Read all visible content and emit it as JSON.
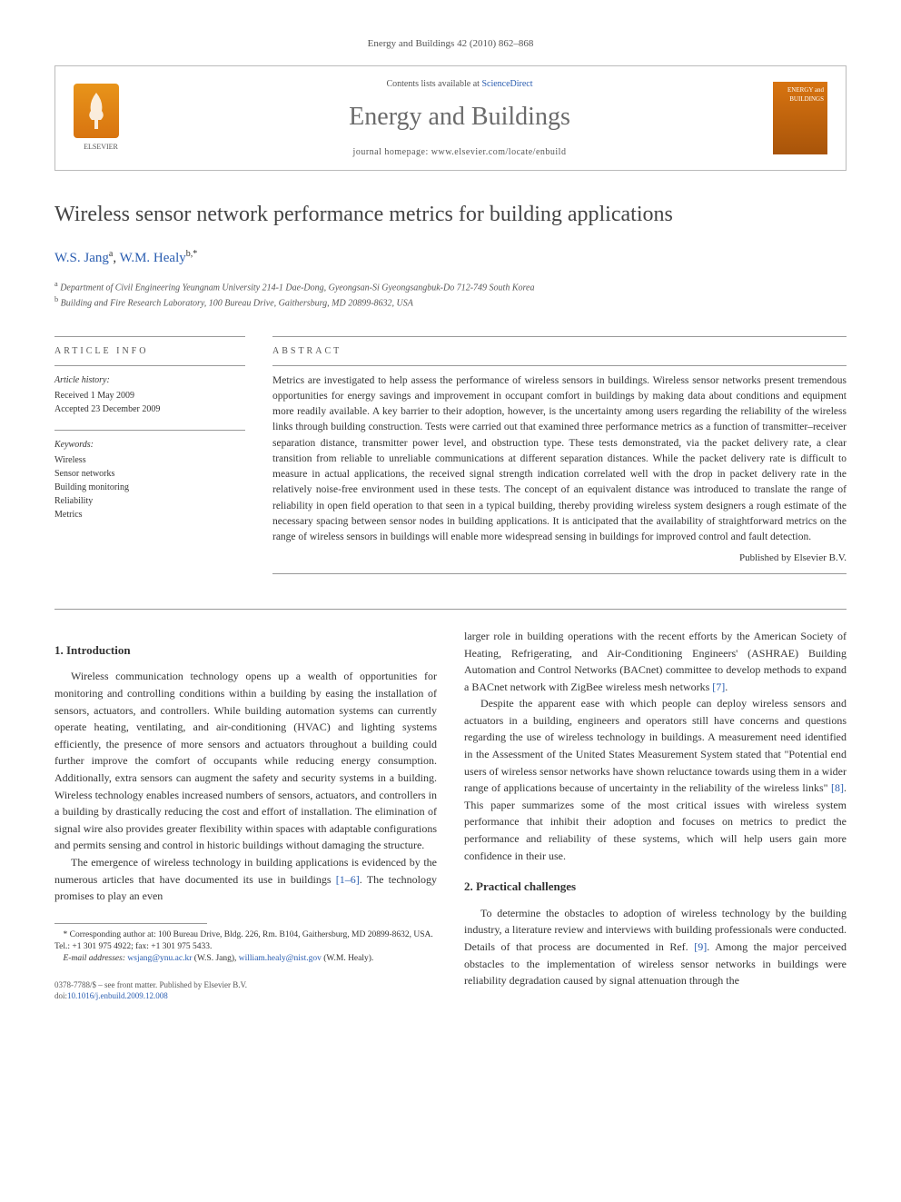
{
  "header": {
    "citation": "Energy and Buildings 42 (2010) 862–868"
  },
  "banner": {
    "contents_prefix": "Contents lists available at ",
    "contents_link": "ScienceDirect",
    "journal_name": "Energy and Buildings",
    "homepage_prefix": "journal homepage: ",
    "homepage_url": "www.elsevier.com/locate/enbuild",
    "elsevier_label": "ELSEVIER",
    "cover_label": "ENERGY and BUILDINGS"
  },
  "article": {
    "title": "Wireless sensor network performance metrics for building applications",
    "authors_html": {
      "a1_name": "W.S. Jang",
      "a1_sup": "a",
      "a2_name": "W.M. Healy",
      "a2_sup": "b,*"
    },
    "affiliations": {
      "a": "Department of Civil Engineering Yeungnam University 214-1 Dae-Dong, Gyeongsan-Si Gyeongsangbuk-Do 712-749 South Korea",
      "b": "Building and Fire Research Laboratory, 100 Bureau Drive, Gaithersburg, MD 20899-8632, USA"
    }
  },
  "info": {
    "heading_info": "ARTICLE INFO",
    "history_label": "Article history:",
    "received": "Received 1 May 2009",
    "accepted": "Accepted 23 December 2009",
    "keywords_label": "Keywords:",
    "keywords": [
      "Wireless",
      "Sensor networks",
      "Building monitoring",
      "Reliability",
      "Metrics"
    ]
  },
  "abstract": {
    "heading": "ABSTRACT",
    "text": "Metrics are investigated to help assess the performance of wireless sensors in buildings. Wireless sensor networks present tremendous opportunities for energy savings and improvement in occupant comfort in buildings by making data about conditions and equipment more readily available. A key barrier to their adoption, however, is the uncertainty among users regarding the reliability of the wireless links through building construction. Tests were carried out that examined three performance metrics as a function of transmitter–receiver separation distance, transmitter power level, and obstruction type. These tests demonstrated, via the packet delivery rate, a clear transition from reliable to unreliable communications at different separation distances. While the packet delivery rate is difficult to measure in actual applications, the received signal strength indication correlated well with the drop in packet delivery rate in the relatively noise-free environment used in these tests. The concept of an equivalent distance was introduced to translate the range of reliability in open field operation to that seen in a typical building, thereby providing wireless system designers a rough estimate of the necessary spacing between sensor nodes in building applications. It is anticipated that the availability of straightforward metrics on the range of wireless sensors in buildings will enable more widespread sensing in buildings for improved control and fault detection.",
    "publisher": "Published by Elsevier B.V."
  },
  "body": {
    "s1_heading": "1. Introduction",
    "s1_p1": "Wireless communication technology opens up a wealth of opportunities for monitoring and controlling conditions within a building by easing the installation of sensors, actuators, and controllers. While building automation systems can currently operate heating, ventilating, and air-conditioning (HVAC) and lighting systems efficiently, the presence of more sensors and actuators throughout a building could further improve the comfort of occupants while reducing energy consumption. Additionally, extra sensors can augment the safety and security systems in a building. Wireless technology enables increased numbers of sensors, actuators, and controllers in a building by drastically reducing the cost and effort of installation. The elimination of signal wire also provides greater flexibility within spaces with adaptable configurations and permits sensing and control in historic buildings without damaging the structure.",
    "s1_p2_pre": "The emergence of wireless technology in building applications is evidenced by the numerous articles that have documented its use in buildings ",
    "s1_p2_ref1": "[1–6]",
    "s1_p2_post": ". The technology promises to play an even",
    "col2_p1_pre": "larger role in building operations with the recent efforts by the American Society of Heating, Refrigerating, and Air-Conditioning Engineers' (ASHRAE) Building Automation and Control Networks (BACnet) committee to develop methods to expand a BACnet network with ZigBee wireless mesh networks ",
    "col2_p1_ref": "[7]",
    "col2_p1_post": ".",
    "col2_p2_pre": "Despite the apparent ease with which people can deploy wireless sensors and actuators in a building, engineers and operators still have concerns and questions regarding the use of wireless technology in buildings. A measurement need identified in the Assessment of the United States Measurement System stated that \"Potential end users of wireless sensor networks have shown reluctance towards using them in a wider range of applications because of uncertainty in the reliability of the wireless links\" ",
    "col2_p2_ref": "[8]",
    "col2_p2_post": ". This paper summarizes some of the most critical issues with wireless system performance that inhibit their adoption and focuses on metrics to predict the performance and reliability of these systems, which will help users gain more confidence in their use.",
    "s2_heading": "2. Practical challenges",
    "s2_p1_pre": "To determine the obstacles to adoption of wireless technology by the building industry, a literature review and interviews with building professionals were conducted. Details of that process are documented in Ref. ",
    "s2_p1_ref": "[9]",
    "s2_p1_post": ". Among the major perceived obstacles to the implementation of wireless sensor networks in buildings were reliability degradation caused by signal attenuation through the"
  },
  "footnotes": {
    "corr_label": "* Corresponding author at: 100 Bureau Drive, Bldg. 226, Rm. B104, Gaithersburg, MD 20899-8632, USA. Tel.: +1 301 975 4922; fax: +1 301 975 5433.",
    "email_label": "E-mail addresses: ",
    "email1": "wsjang@ynu.ac.kr",
    "email1_owner": " (W.S. Jang), ",
    "email2": "william.healy@nist.gov",
    "email2_owner": " (W.M. Healy)."
  },
  "footer": {
    "issn_line": "0378-7788/$ – see front matter. Published by Elsevier B.V.",
    "doi_prefix": "doi:",
    "doi": "10.1016/j.enbuild.2009.12.008"
  }
}
